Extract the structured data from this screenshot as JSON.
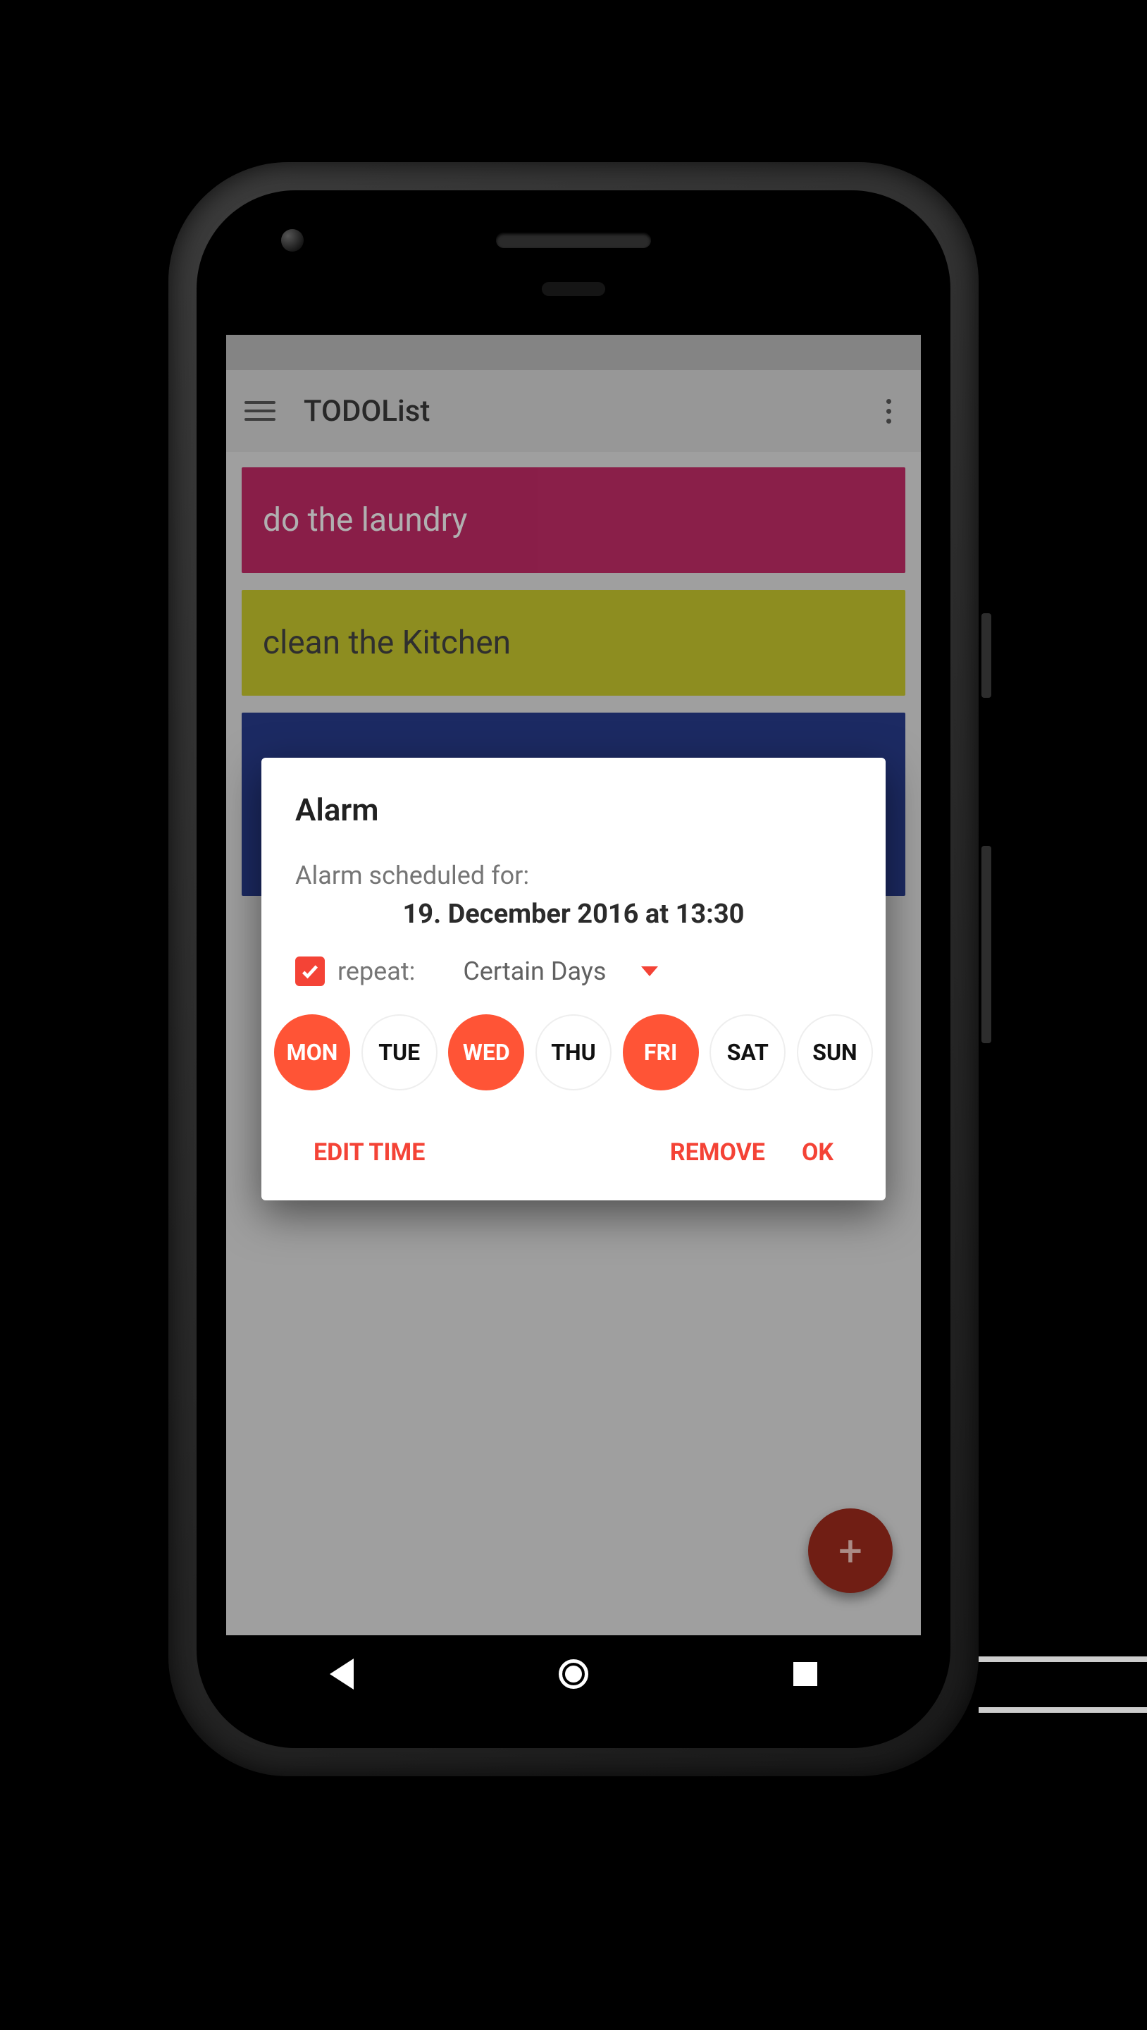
{
  "app": {
    "title": "TODOList",
    "tasks": [
      {
        "label": "do the laundry",
        "color": "pink"
      },
      {
        "label": "clean the Kitchen",
        "color": "yellow"
      },
      {
        "label": "",
        "color": "blue"
      }
    ],
    "fab_label": "+"
  },
  "dialog": {
    "title": "Alarm",
    "scheduled_label": "Alarm scheduled for:",
    "scheduled_value": "19. December 2016 at 13:30",
    "repeat_checked": true,
    "repeat_label": "repeat:",
    "repeat_mode": "Certain Days",
    "days": [
      {
        "abbr": "MON",
        "selected": true
      },
      {
        "abbr": "TUE",
        "selected": false
      },
      {
        "abbr": "WED",
        "selected": true
      },
      {
        "abbr": "THU",
        "selected": false
      },
      {
        "abbr": "FRI",
        "selected": true
      },
      {
        "abbr": "SAT",
        "selected": false
      },
      {
        "abbr": "SUN",
        "selected": false
      }
    ],
    "actions": {
      "edit_time": "EDIT TIME",
      "remove": "REMOVE",
      "ok": "OK"
    }
  },
  "colors": {
    "accent": "#f44336",
    "fab": "#a12c1e"
  }
}
